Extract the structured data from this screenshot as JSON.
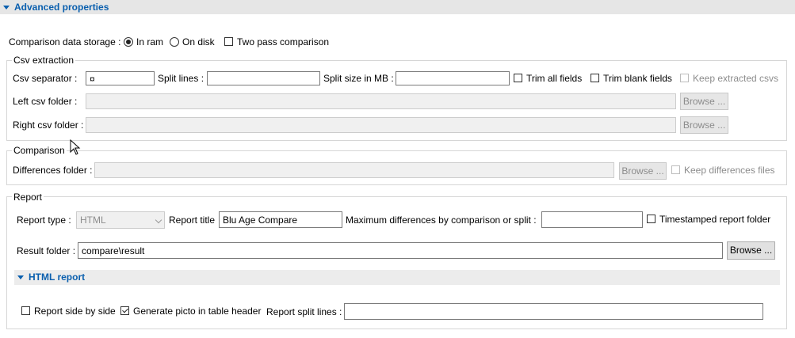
{
  "advanced": {
    "title": "Advanced properties"
  },
  "storage": {
    "label": "Comparison data storage :",
    "in_ram": "In ram",
    "on_disk": "On disk",
    "selected": "In ram",
    "two_pass": "Two pass comparison",
    "two_pass_checked": false
  },
  "csv": {
    "legend": "Csv extraction",
    "separator_label": "Csv separator :",
    "separator_value": "¤",
    "split_lines_label": "Split lines :",
    "split_lines_value": "",
    "split_size_label": "Split size in MB :",
    "split_size_value": "",
    "trim_all": "Trim all fields",
    "trim_blank": "Trim blank fields",
    "keep_extracted": "Keep extracted csvs",
    "left_folder_label": "Left csv folder :",
    "left_folder_value": "",
    "right_folder_label": "Right csv folder :",
    "right_folder_value": "",
    "browse": "Browse ..."
  },
  "comparison": {
    "legend": "Comparison",
    "differences_label": "Differences folder :",
    "differences_value": "",
    "browse": "Browse ...",
    "keep_differences": "Keep differences files"
  },
  "report": {
    "legend": "Report",
    "type_label": "Report type :",
    "type_value": "HTML",
    "title_label": "Report title",
    "title_value": "Blu Age Compare",
    "max_diff_label": "Maximum differences by comparison or split :",
    "max_diff_value": "",
    "timestamped": "Timestamped report folder",
    "result_folder_label": "Result folder :",
    "result_folder_value": "compare\\result",
    "browse": "Browse ..."
  },
  "html_report": {
    "title": "HTML report",
    "side_by_side": "Report side by side",
    "side_by_side_checked": false,
    "picto": "Generate picto in table header",
    "picto_checked": true,
    "split_lines_label": "Report split lines :",
    "split_lines_value": ""
  },
  "colors": {
    "accent": "#0a5fae",
    "bar": "#e6e6e6"
  }
}
